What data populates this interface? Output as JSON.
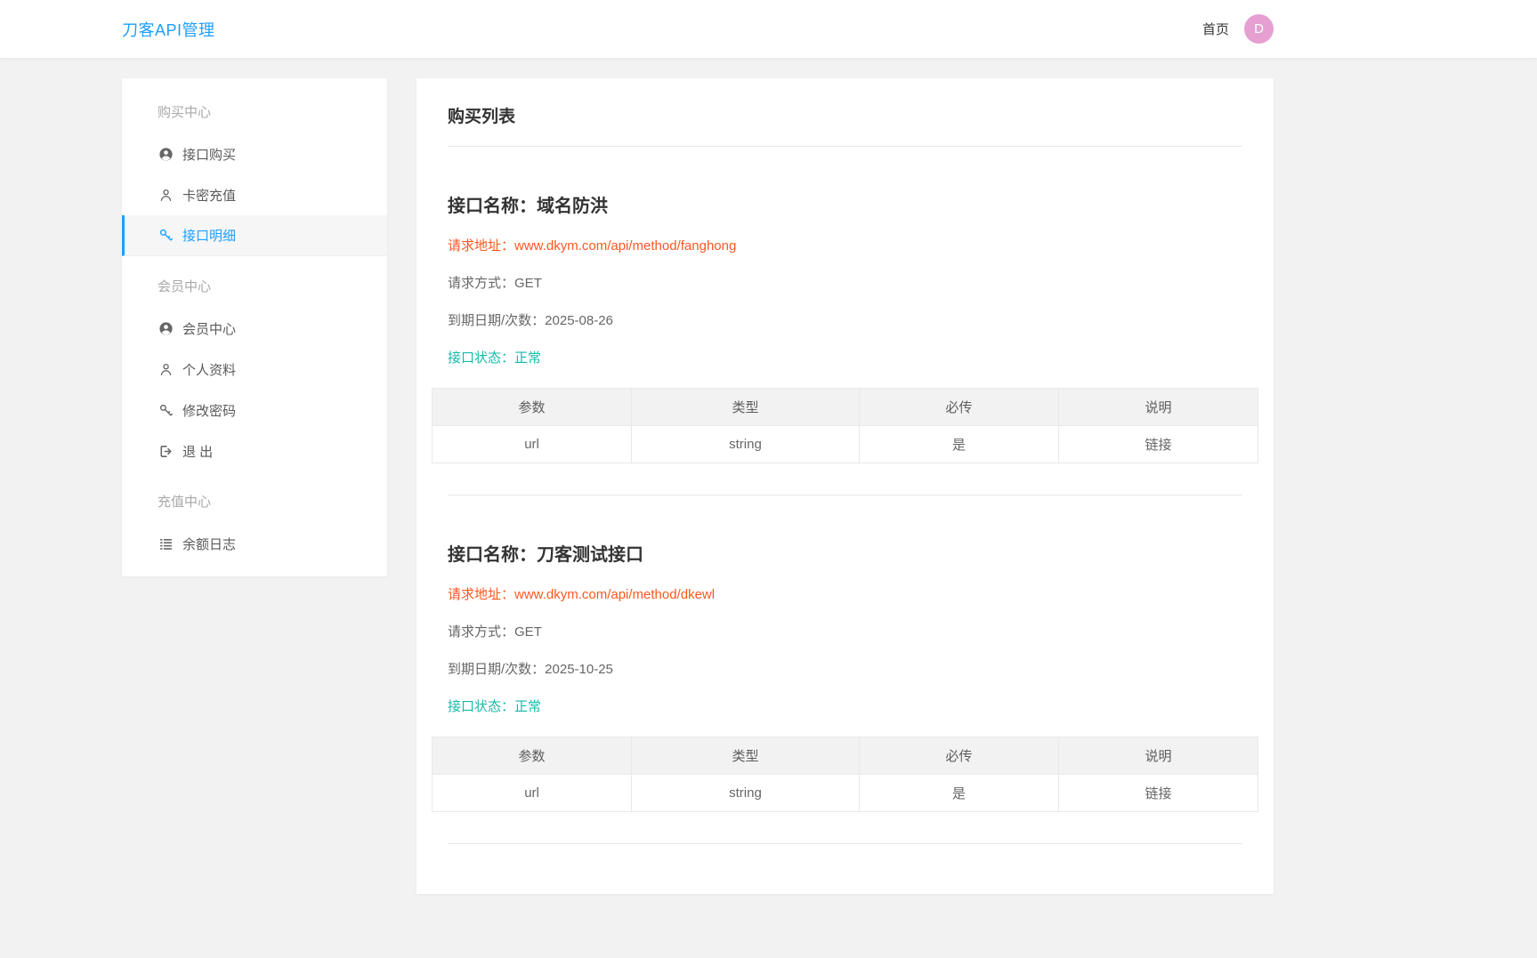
{
  "header": {
    "brand": "刀客API管理",
    "nav_home": "首页",
    "avatar_letter": "D"
  },
  "sidebar": {
    "groups": [
      {
        "title": "购买中心",
        "items": [
          {
            "icon": "user-circle-icon",
            "label": "接口购买",
            "active": false
          },
          {
            "icon": "user-outline-icon",
            "label": "卡密充值",
            "active": false
          },
          {
            "icon": "key-icon",
            "label": "接口明细",
            "active": true
          }
        ]
      },
      {
        "title": "会员中心",
        "items": [
          {
            "icon": "user-circle-icon",
            "label": "会员中心",
            "active": false
          },
          {
            "icon": "user-outline-icon",
            "label": "个人资料",
            "active": false
          },
          {
            "icon": "key-icon",
            "label": "修改密码",
            "active": false
          },
          {
            "icon": "logout-icon",
            "label": "退 出",
            "active": false
          }
        ]
      },
      {
        "title": "充值中心",
        "items": [
          {
            "icon": "list-icon",
            "label": "余额日志",
            "active": false
          }
        ]
      }
    ]
  },
  "main": {
    "title": "购买列表",
    "apis": [
      {
        "name_label": "接口名称：",
        "name": "域名防洪",
        "url_label": "请求地址：",
        "url": "www.dkym.com/api/method/fanghong",
        "method_label": "请求方式：",
        "method": "GET",
        "expire_label": "到期日期/次数：",
        "expire": "2025-08-26",
        "status_label": "接口状态：",
        "status": "正常",
        "table": {
          "headers": [
            "参数",
            "类型",
            "必传",
            "说明"
          ],
          "rows": [
            [
              "url",
              "string",
              "是",
              "链接"
            ]
          ]
        }
      },
      {
        "name_label": "接口名称：",
        "name": "刀客测试接口",
        "url_label": "请求地址：",
        "url": "www.dkym.com/api/method/dkewl",
        "method_label": "请求方式：",
        "method": "GET",
        "expire_label": "到期日期/次数：",
        "expire": "2025-10-25",
        "status_label": "接口状态：",
        "status": "正常",
        "table": {
          "headers": [
            "参数",
            "类型",
            "必传",
            "说明"
          ],
          "rows": [
            [
              "url",
              "string",
              "是",
              "链接"
            ]
          ]
        }
      }
    ]
  },
  "colors": {
    "accent_blue": "#1e9fff",
    "url_red": "#ff5722",
    "status_green": "#16baaa",
    "avatar_pink": "#e59fd1"
  }
}
